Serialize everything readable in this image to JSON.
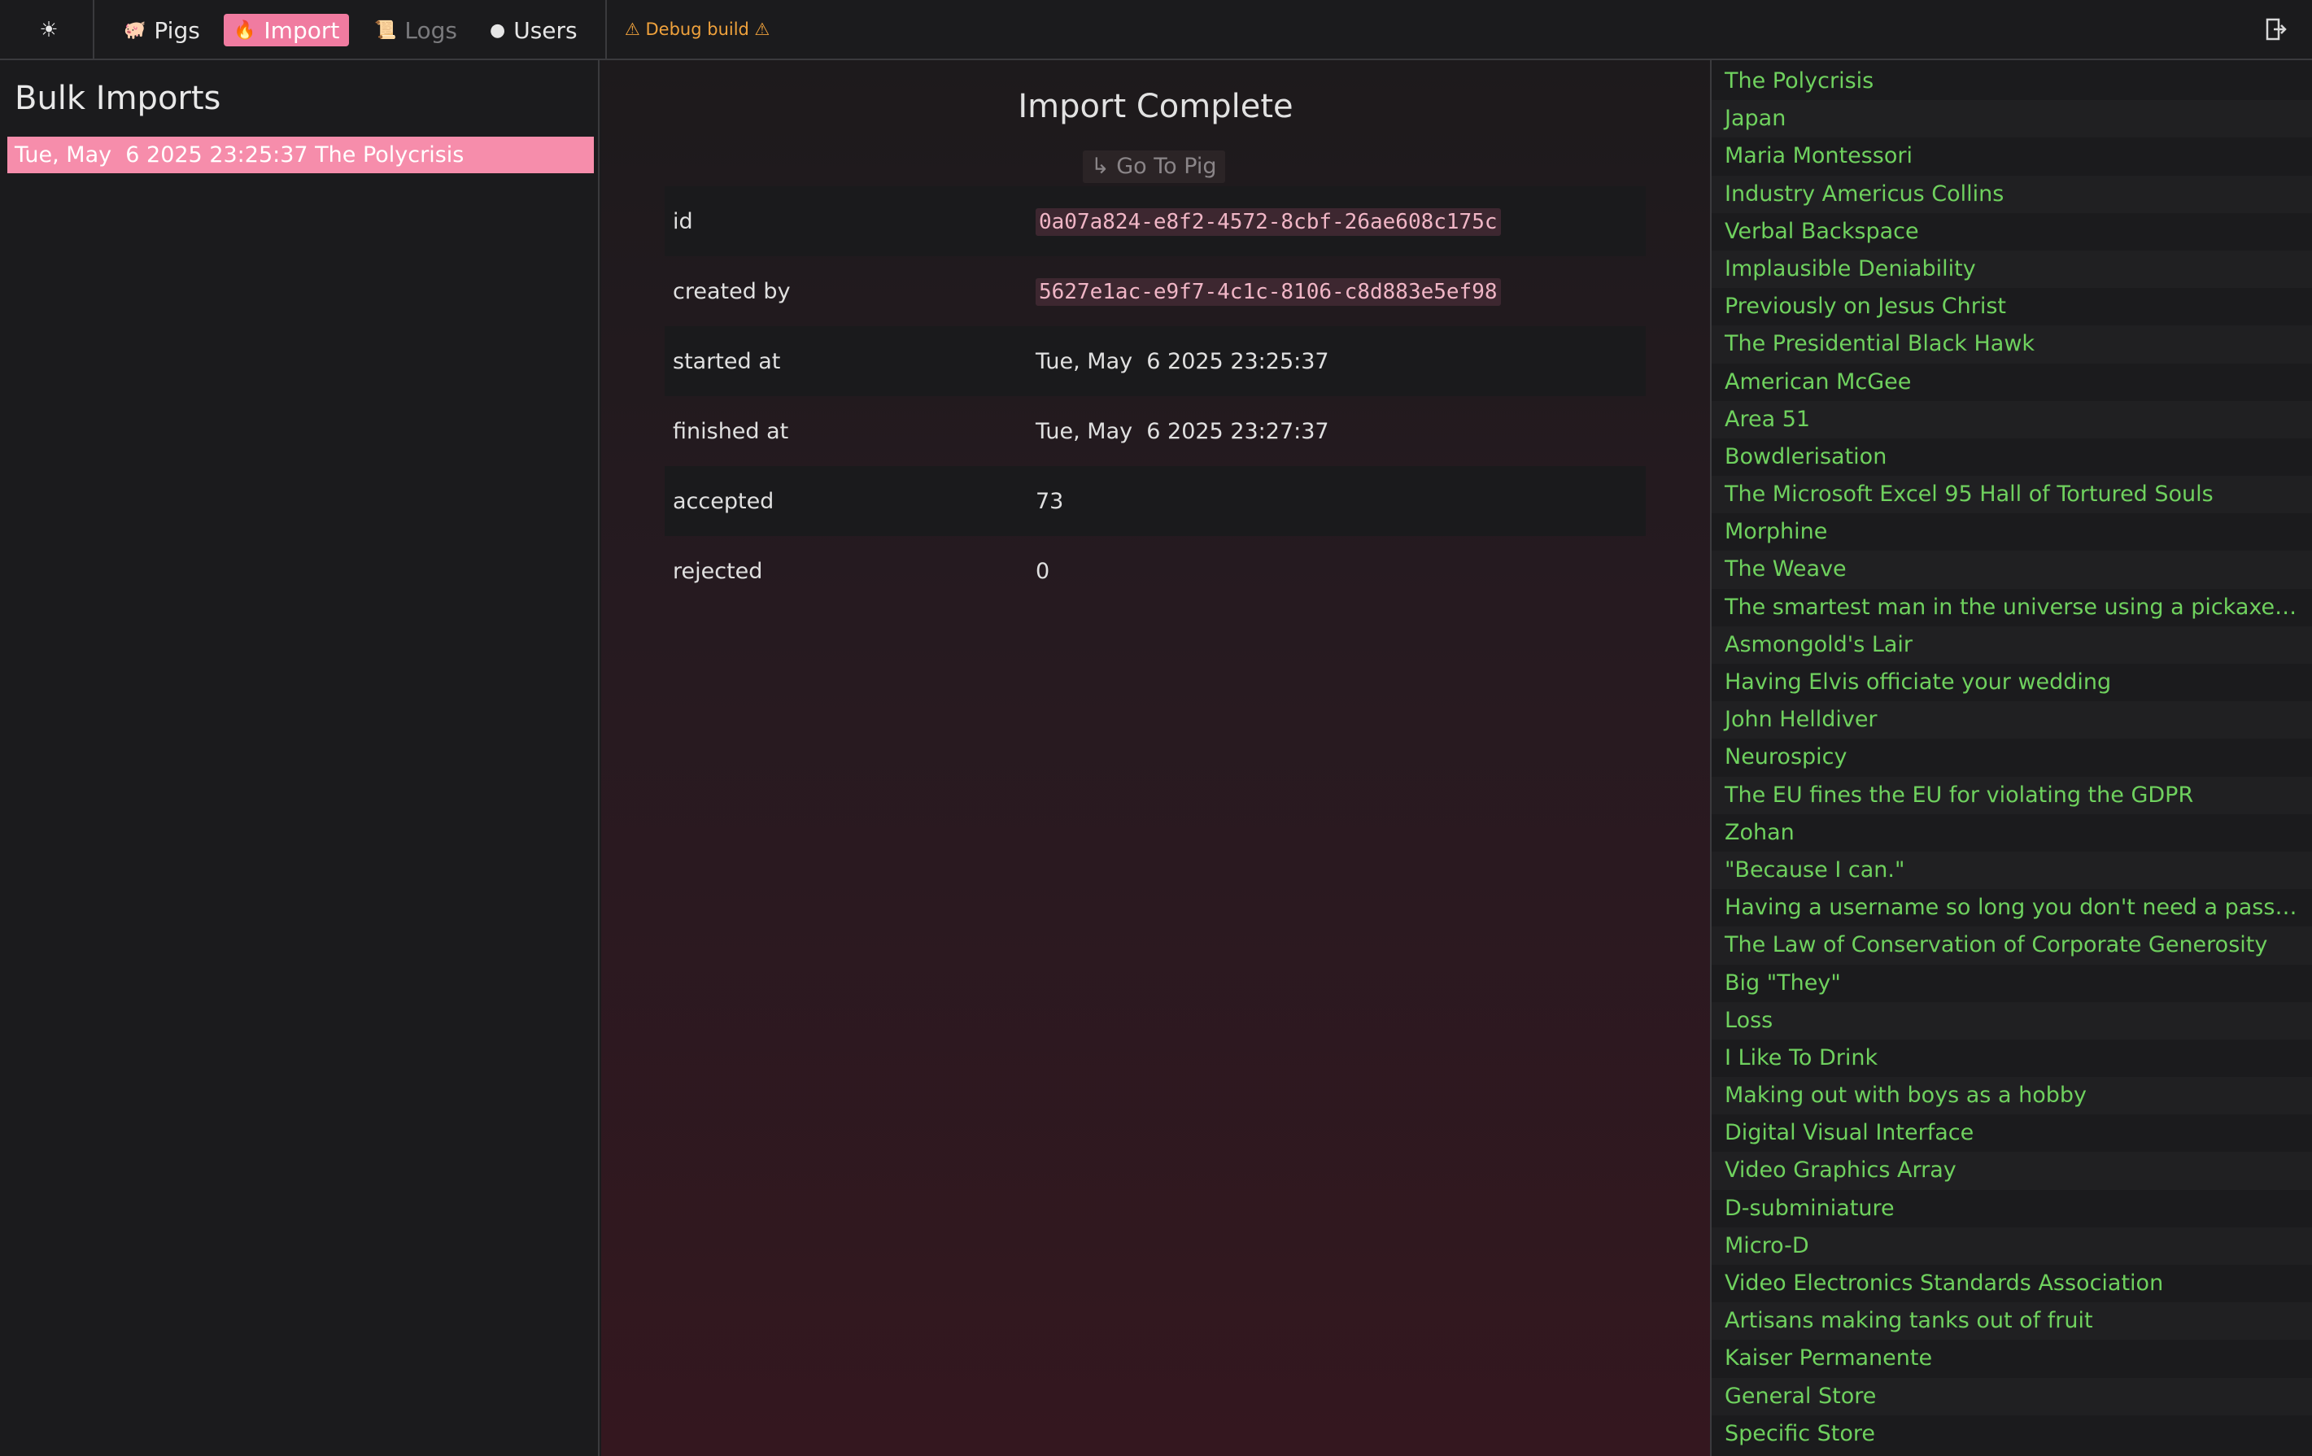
{
  "nav": {
    "theme_icon": "sun-icon",
    "items": [
      {
        "label": "Pigs",
        "icon": "pig-icon"
      },
      {
        "label": "Import",
        "icon": "fire-icon"
      },
      {
        "label": "Logs",
        "icon": "scroll-icon"
      },
      {
        "label": "Users",
        "icon": "user-icon"
      }
    ],
    "debug_label": "⚠ Debug build ⚠",
    "logout_icon": "logout-icon"
  },
  "left": {
    "title": "Bulk Imports",
    "imports": [
      "Tue, May  6 2025 23:25:37 The Polycrisis"
    ]
  },
  "detail": {
    "title": "Import Complete",
    "goto_label": "↳ Go To Pig",
    "fields": [
      {
        "key": "id",
        "value": "0a07a824-e8f2-4572-8cbf-26ae608c175c"
      },
      {
        "key": "created by",
        "value": "5627e1ac-e9f7-4c1c-8106-c8d883e5ef98"
      },
      {
        "key": "started at",
        "value": "Tue, May  6 2025 23:25:37"
      },
      {
        "key": "finished at",
        "value": "Tue, May  6 2025 23:27:37"
      },
      {
        "key": "accepted",
        "value": "73"
      },
      {
        "key": "rejected",
        "value": "0"
      }
    ]
  },
  "pigs": [
    "The Polycrisis",
    "Japan",
    "Maria Montessori",
    "Industry Americus Collins",
    "Verbal Backspace",
    "Implausible Deniability",
    "Previously on Jesus Christ",
    "The Presidential Black Hawk",
    "American McGee",
    "Area 51",
    "Bowdlerisation",
    "The Microsoft Excel 95 Hall of Tortured Souls",
    "Morphine",
    "The Weave",
    "The smartest man in the universe using a pickaxe to dig a hole",
    "Asmongold's Lair",
    "Having Elvis officiate your wedding",
    "John Helldiver",
    "Neurospicy",
    "The EU fines the EU for violating the GDPR",
    "Zohan",
    "\"Because I can.\"",
    "Having a username so long you don't need a password",
    "The Law of Conservation of Corporate Generosity",
    "Big \"They\"",
    "Loss",
    "I Like To Drink",
    "Making out with boys as a hobby",
    "Digital Visual Interface",
    "Video Graphics Array",
    "D-subminiature",
    "Micro-D",
    "Video Electronics Standards Association",
    "Artisans making tanks out of fruit",
    "Kaiser Permanente",
    "General Store",
    "Specific Store"
  ]
}
